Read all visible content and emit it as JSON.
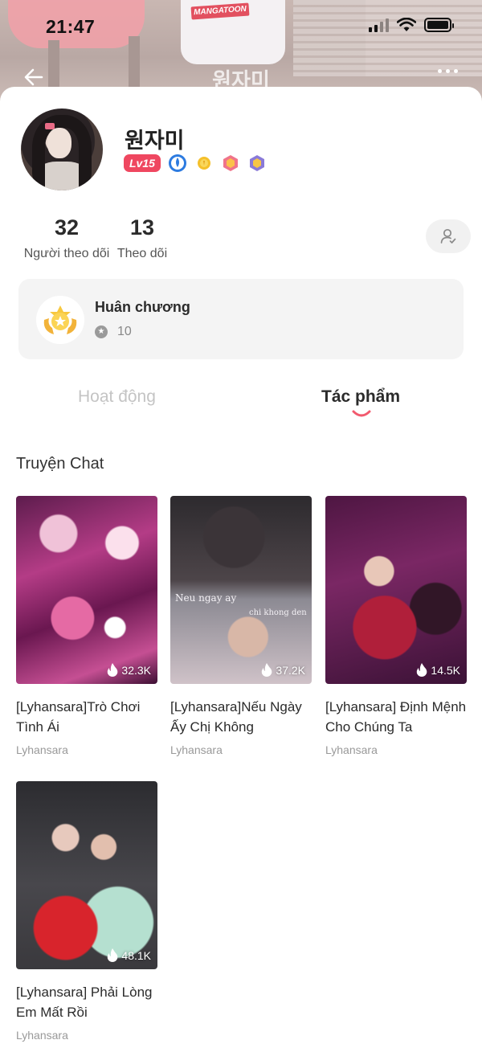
{
  "status_bar": {
    "time": "21:47"
  },
  "header": {
    "title": "원자미",
    "banner_shirt_text": "MANGATOON"
  },
  "profile": {
    "name": "원자미",
    "level": "Lv15",
    "followers_count": "32",
    "followers_label": "Người theo dõi",
    "following_count": "13",
    "following_label": "Theo dõi"
  },
  "medal_card": {
    "title": "Huân chương",
    "count": "10"
  },
  "tabs": [
    {
      "label": "Hoạt động",
      "active": false
    },
    {
      "label": "Tác phẩm",
      "active": true
    }
  ],
  "section": {
    "title": "Truyện Chat"
  },
  "works": [
    {
      "title": "[Lyhansara]Trò Chơi Tình Ái",
      "author": "Lyhansara",
      "views": "32.3K"
    },
    {
      "title": "[Lyhansara]Nếu Ngày Ấy Chị Không",
      "author": "Lyhansara",
      "views": "37.2K",
      "cover_lines": [
        "Neu ngay ay",
        "chi khong den"
      ]
    },
    {
      "title": "[Lyhansara] Định Mệnh Cho Chúng Ta",
      "author": "Lyhansara",
      "views": "14.5K"
    },
    {
      "title": "[Lyhansara] Phải Lòng Em Mất Rồi",
      "author": "Lyhansara",
      "views": "48.1K"
    }
  ],
  "colors": {
    "accent": "#ef4760",
    "tab_indicator": "#f25a6e",
    "muted": "#999999"
  },
  "icons": [
    "back-arrow-icon",
    "more-icon",
    "signal-icon",
    "wifi-icon",
    "battery-icon",
    "follow-user-icon",
    "medal-icon",
    "star-icon",
    "fire-icon"
  ]
}
